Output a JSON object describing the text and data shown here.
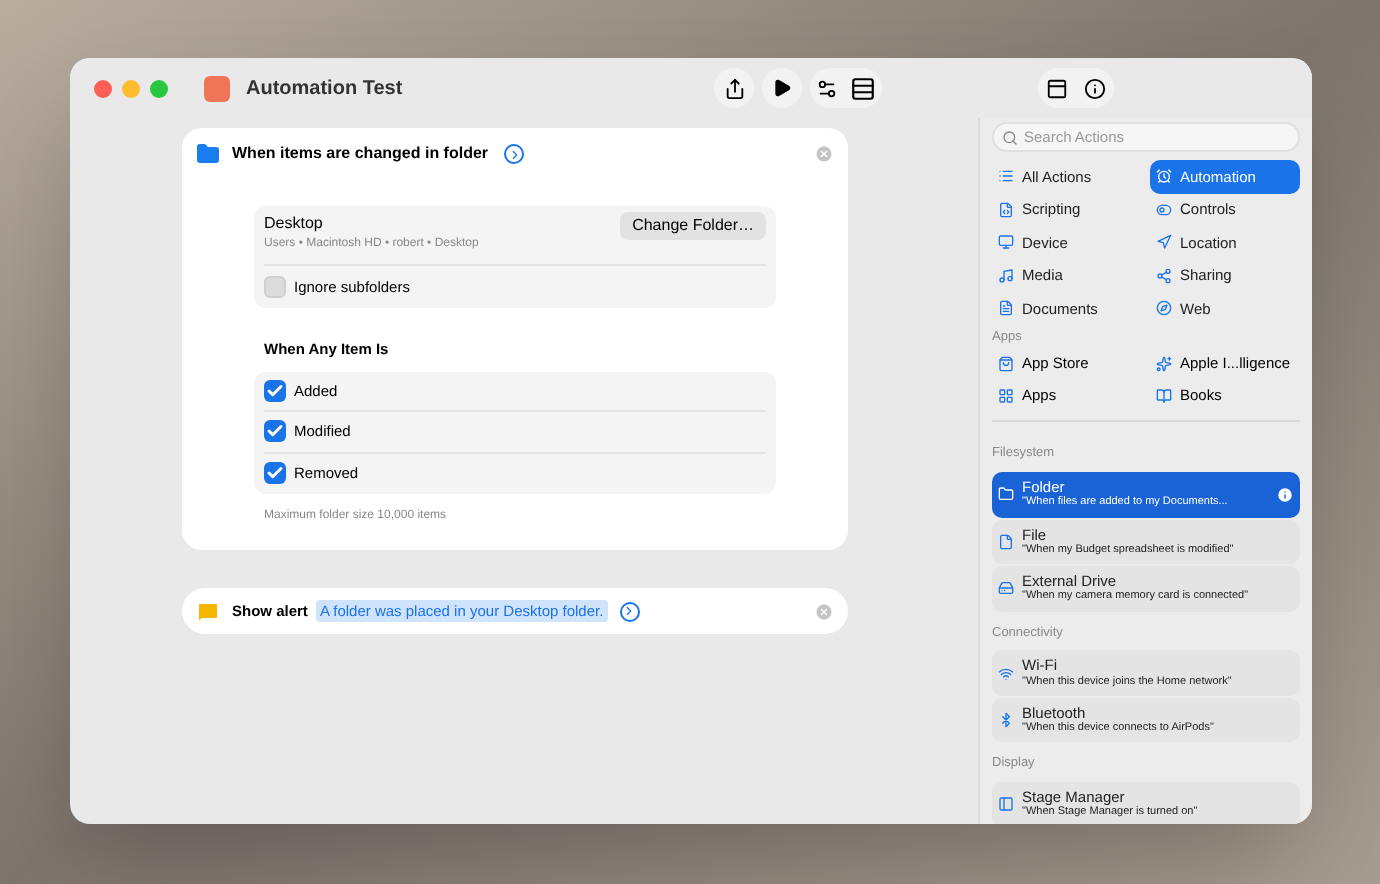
{
  "window": {
    "title": "Automation Test"
  },
  "trigger": {
    "title": "When items are changed in folder",
    "folder": {
      "name": "Desktop",
      "path": "Users • Macintosh HD • robert • Desktop",
      "button": "Change Folder…"
    },
    "ignore_subfolders": {
      "label": "Ignore subfolders",
      "checked": false
    },
    "section_title": "When Any Item Is",
    "options": [
      {
        "label": "Added",
        "checked": true
      },
      {
        "label": "Modified",
        "checked": true
      },
      {
        "label": "Removed",
        "checked": true
      }
    ],
    "footnote": "Maximum folder size 10,000 items"
  },
  "action": {
    "title": "Show alert",
    "token": "A folder was placed in your Desktop folder."
  },
  "sidebar": {
    "search": {
      "placeholder": "Search Actions"
    },
    "categories": [
      {
        "label": "All Actions",
        "selected": false
      },
      {
        "label": "Automation",
        "selected": true
      },
      {
        "label": "Scripting",
        "selected": false
      },
      {
        "label": "Controls",
        "selected": false
      },
      {
        "label": "Device",
        "selected": false
      },
      {
        "label": "Location",
        "selected": false
      },
      {
        "label": "Media",
        "selected": false
      },
      {
        "label": "Sharing",
        "selected": false
      },
      {
        "label": "Documents",
        "selected": false
      },
      {
        "label": "Web",
        "selected": false
      }
    ],
    "apps_heading": "Apps",
    "apps": [
      {
        "label": "App Store"
      },
      {
        "label": "Apple I...lligence"
      },
      {
        "label": "Apps"
      },
      {
        "label": "Books"
      }
    ],
    "groups": [
      {
        "heading": "Filesystem",
        "items": [
          {
            "title": "Folder",
            "subtitle": "\"When files are added to my Documents...",
            "selected": true
          },
          {
            "title": "File",
            "subtitle": "\"When my Budget spreadsheet is modified\"",
            "selected": false
          },
          {
            "title": "External Drive",
            "subtitle": "\"When my camera memory card is connected\"",
            "selected": false
          }
        ]
      },
      {
        "heading": "Connectivity",
        "items": [
          {
            "title": "Wi-Fi",
            "subtitle": "\"When this device joins the Home network\"",
            "selected": false
          },
          {
            "title": "Bluetooth",
            "subtitle": "\"When this device connects to AirPods\"",
            "selected": false
          }
        ]
      },
      {
        "heading": "Display",
        "items": [
          {
            "title": "Stage Manager",
            "subtitle": "\"When Stage Manager is turned on\"",
            "selected": false
          }
        ]
      }
    ]
  }
}
